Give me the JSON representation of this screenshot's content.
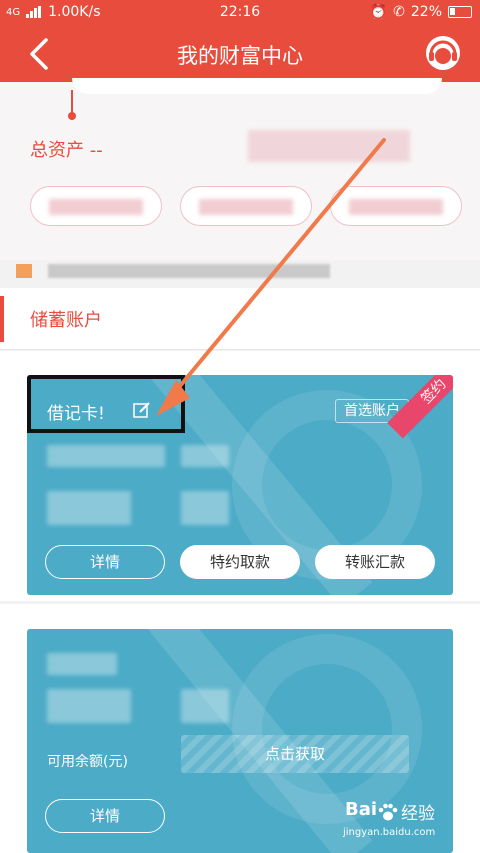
{
  "status_bar": {
    "network": "4G",
    "speed": "1.00K/s",
    "time": "22:16",
    "battery": "22%"
  },
  "nav": {
    "title": "我的财富中心",
    "back_icon": "chevron-left-icon",
    "service_icon": "customer-service-icon"
  },
  "assets": {
    "label": "总资产 --"
  },
  "section": {
    "title": "储蓄账户"
  },
  "card1": {
    "title": "借记卡!",
    "edit_icon": "edit-icon",
    "pref_label": "首选账户",
    "ribbon": "签约",
    "buttons": [
      "详情",
      "特约取款",
      "转账汇款"
    ]
  },
  "card2": {
    "available_label": "可用余额(元)",
    "fetch_label": "点击获取",
    "detail_label": "详情"
  },
  "watermark": {
    "brand": "Bai",
    "sub": "经验",
    "url": "jingyan.baidu.com"
  },
  "colors": {
    "accent": "#e84c3d",
    "card": "#4cabc7",
    "ribbon": "#e8466a",
    "annotation_arrow": "#f07a4a"
  }
}
